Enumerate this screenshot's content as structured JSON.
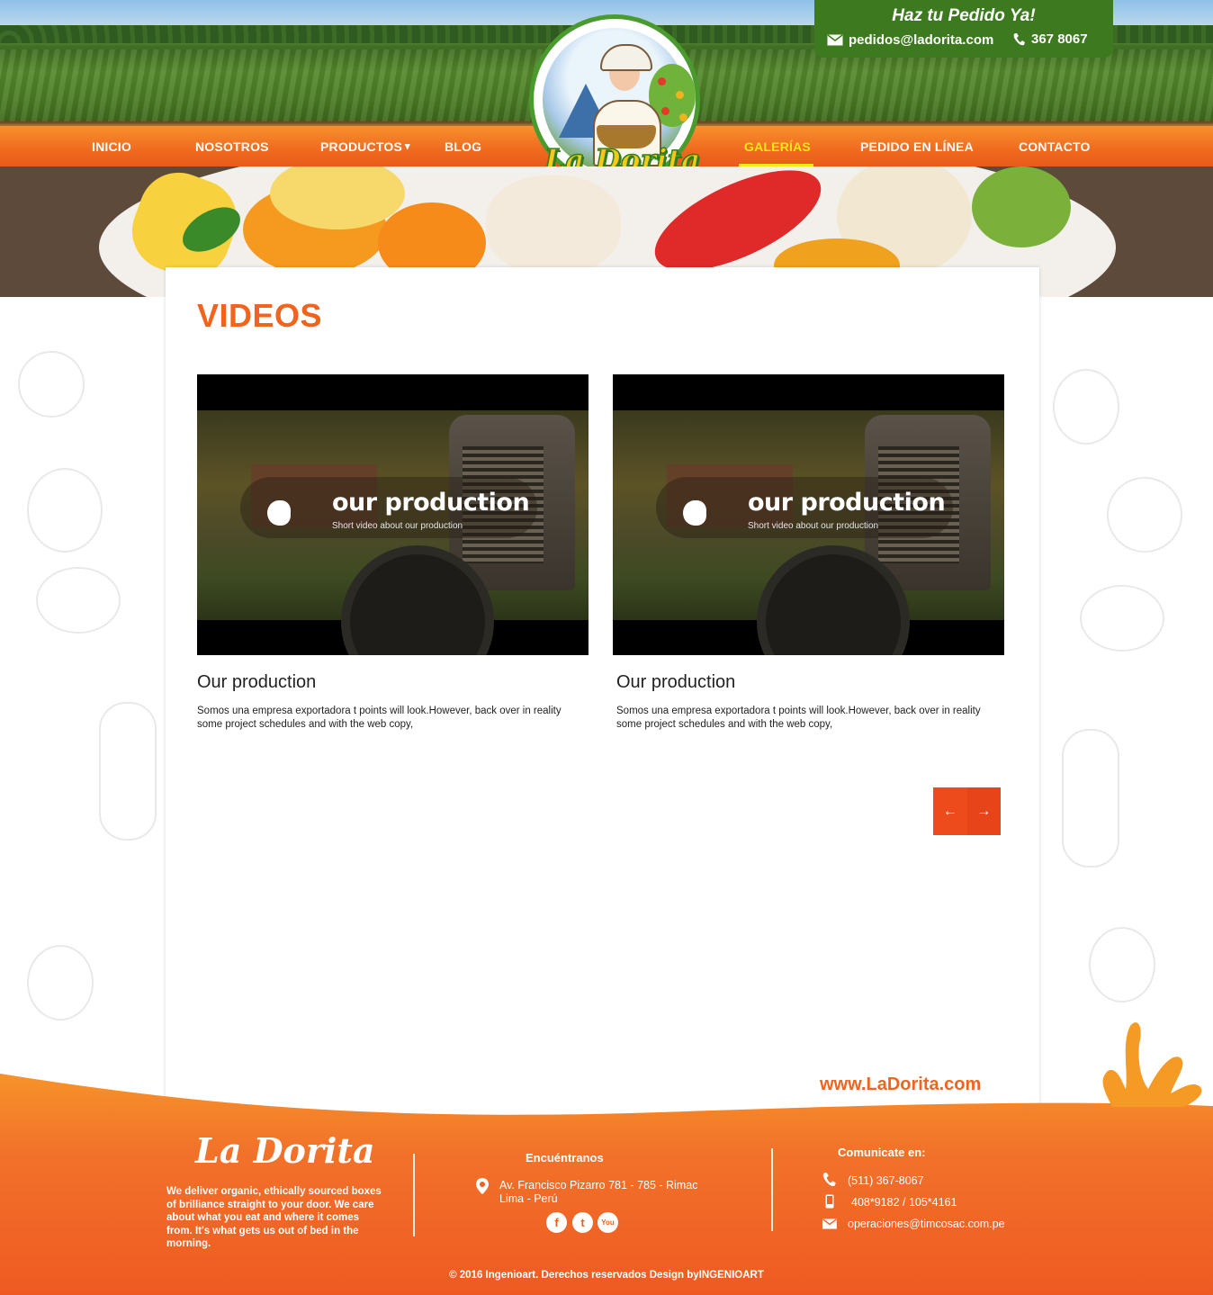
{
  "header": {
    "order_title": "Haz tu Pedido Ya!",
    "email": "pedidos@ladorita.com",
    "phone": "367 8067",
    "logo_text": "La Dorita"
  },
  "nav": {
    "items": [
      {
        "label": "INICIO"
      },
      {
        "label": "NOSOTROS"
      },
      {
        "label": "PRODUCTOS"
      },
      {
        "label": "BLOG"
      },
      {
        "label": "GALERÍAS",
        "active": true
      },
      {
        "label": "PEDIDO EN LÍNEA"
      },
      {
        "label": "CONTACTO"
      }
    ],
    "dropdown_caret": "▾"
  },
  "main": {
    "title": "VIDEOS",
    "videos": [
      {
        "overlay_title": "our production",
        "overlay_subtitle": "Short video about our production",
        "title": "Our production",
        "description": "Somos una empresa exportadora t points will look.However, back over in reality some project schedules and with the web copy,"
      },
      {
        "overlay_title": "our production",
        "overlay_subtitle": "Short video about our production",
        "title": "Our production",
        "description": "Somos una empresa exportadora t points will look.However, back over in reality some project schedules and with the web copy,"
      }
    ],
    "pager": {
      "prev": "←",
      "next": "→"
    },
    "site_url": "www.LaDorita.com"
  },
  "footer": {
    "brand": "La Dorita",
    "about": "We deliver organic, ethically sourced boxes of brilliance straight to your door. We care about what you eat and where it comes from. It's what gets us out of bed in the morning.",
    "find_us": {
      "heading": "Encuéntranos",
      "address_line1": "Av. Francisco Pizarro 781 - 785 - Rimac",
      "address_line2": "Lima - Perú",
      "social": [
        {
          "name": "facebook",
          "glyph": "f"
        },
        {
          "name": "twitter",
          "glyph": "t"
        },
        {
          "name": "youtube",
          "glyph": "You"
        }
      ]
    },
    "contact": {
      "heading": "Comunicate  en:",
      "phone": "(511) 367-8067",
      "mobile": "408*9182 / 105*4161",
      "email": "operaciones@timcosac.com.pe"
    },
    "copyright": "© 2016 Ingenioart. Derechos reservados Design byINGENIOART"
  },
  "colors": {
    "brand_orange": "#f0641e",
    "nav_active": "#f6e61a",
    "header_green": "#3d7a1f"
  },
  "icons": [
    "mail-icon",
    "phone-icon",
    "play-icon",
    "arrow-left-icon",
    "arrow-right-icon",
    "location-pin-icon",
    "mobile-icon",
    "facebook-icon",
    "twitter-icon",
    "youtube-icon"
  ]
}
